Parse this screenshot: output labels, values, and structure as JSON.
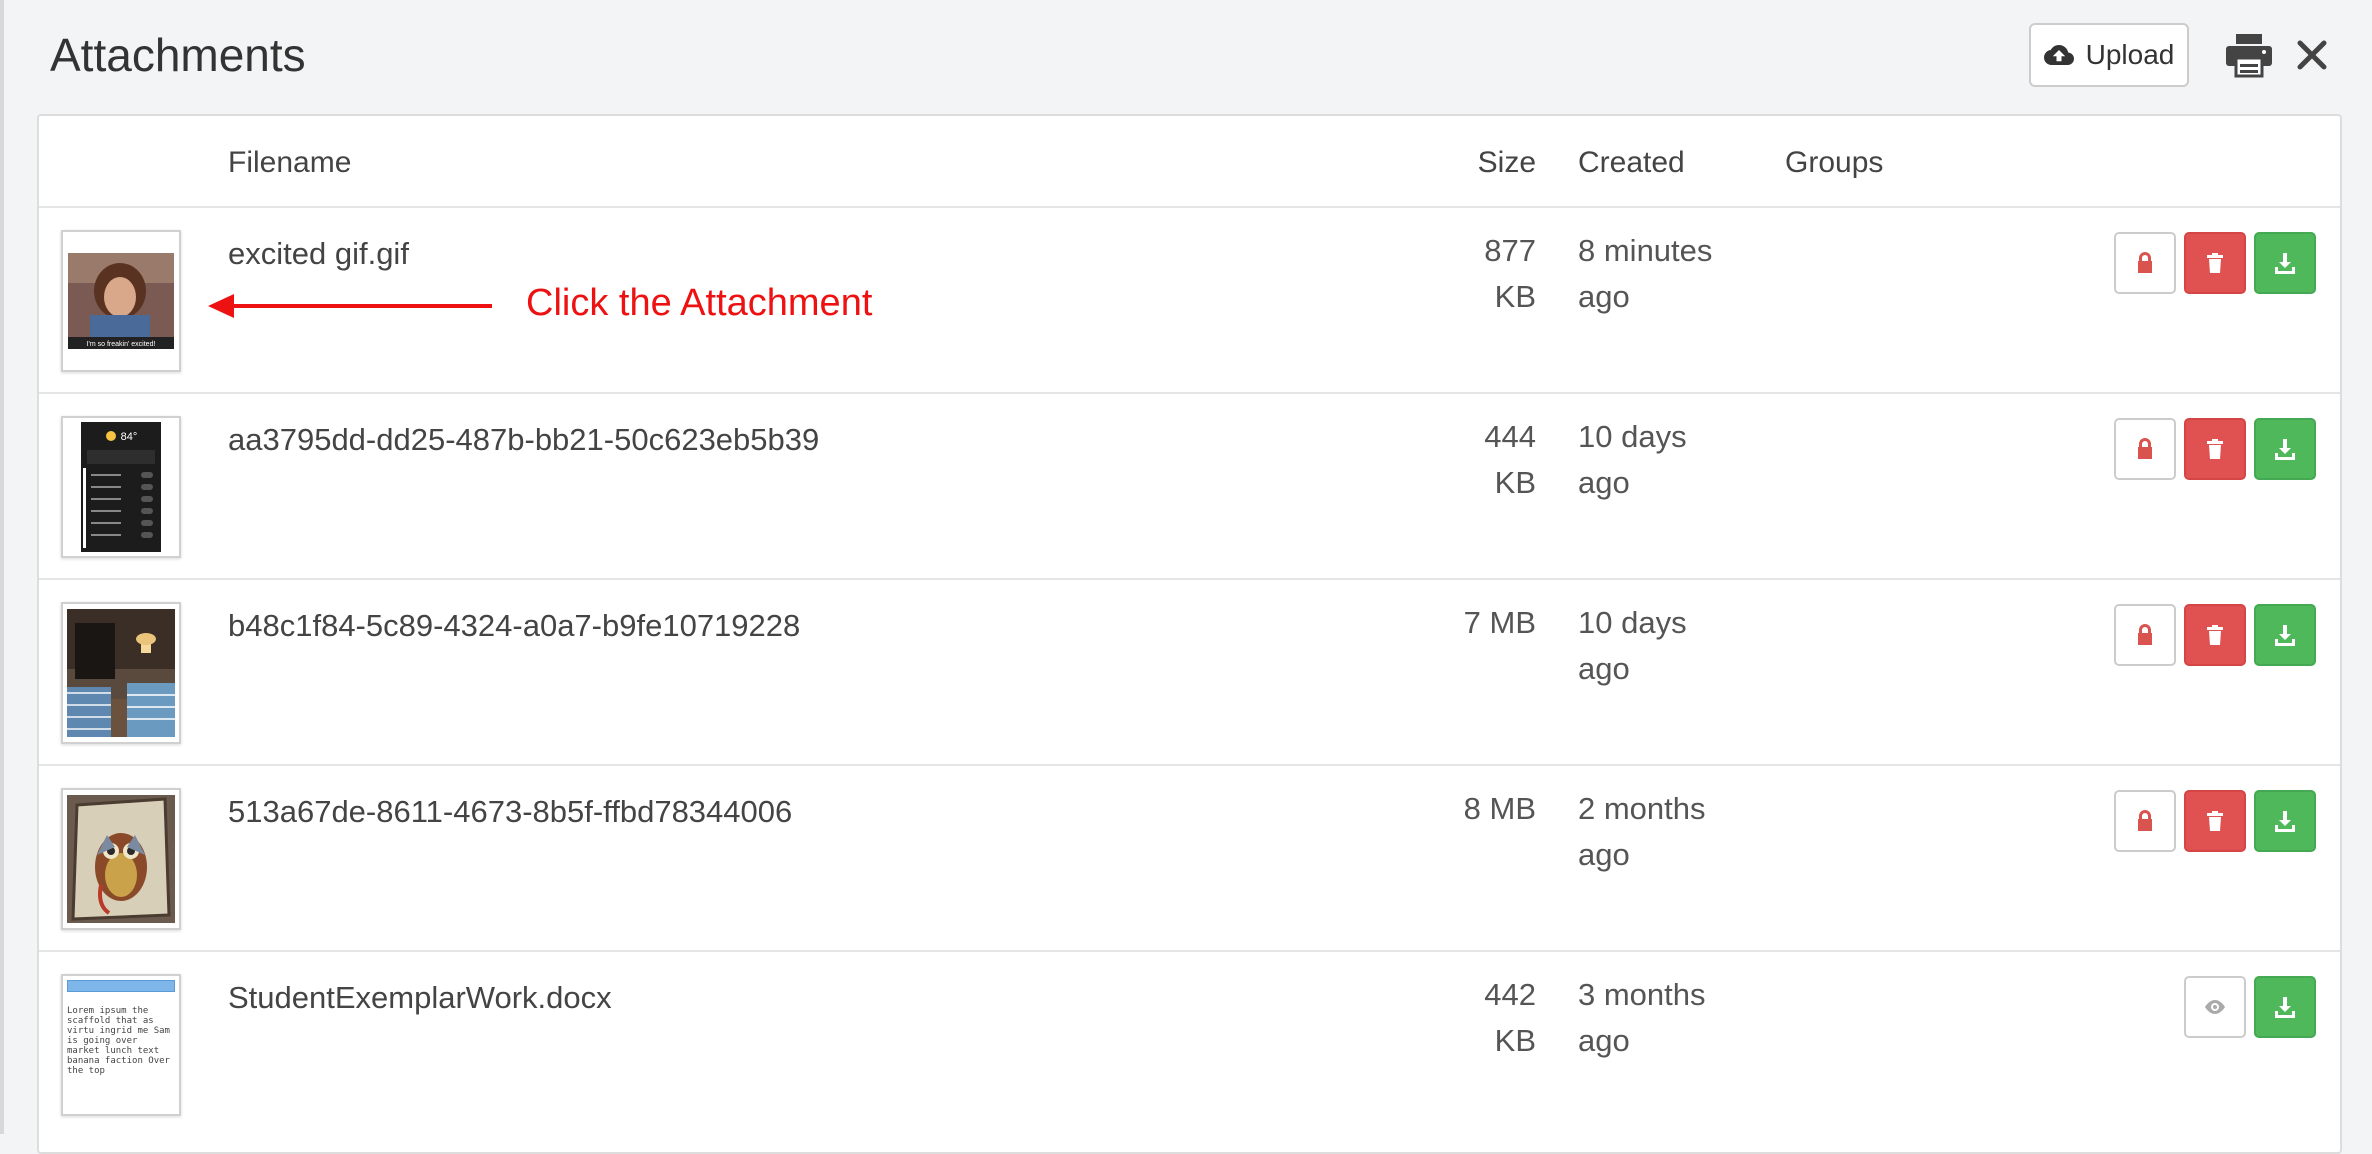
{
  "header": {
    "title": "Attachments",
    "upload_label": "Upload"
  },
  "table": {
    "columns": [
      "Filename",
      "Size",
      "Created",
      "Groups"
    ],
    "rows": [
      {
        "filename": "excited gif.gif",
        "size_line1": "877",
        "size_line2": "KB",
        "created_line1": "8 minutes",
        "created_line2": "ago",
        "thumb_caption": "I'm so freakin' excited!",
        "actions": [
          "lock",
          "delete",
          "download"
        ]
      },
      {
        "filename": "aa3795dd-dd25-487b-bb21-50c623eb5b39",
        "size_line1": "444",
        "size_line2": "KB",
        "created_line1": "10 days",
        "created_line2": "ago",
        "thumb_caption": "84°",
        "actions": [
          "lock",
          "delete",
          "download"
        ]
      },
      {
        "filename": "b48c1f84-5c89-4324-a0a7-b9fe10719228",
        "size_line1": "7 MB",
        "size_line2": "",
        "created_line1": "10 days",
        "created_line2": "ago",
        "thumb_caption": "",
        "actions": [
          "lock",
          "delete",
          "download"
        ]
      },
      {
        "filename": "513a67de-8611-4673-8b5f-ffbd78344006",
        "size_line1": "8 MB",
        "size_line2": "",
        "created_line1": "2 months",
        "created_line2": "ago",
        "thumb_caption": "",
        "actions": [
          "lock",
          "delete",
          "download"
        ]
      },
      {
        "filename": "StudentExemplarWork.docx",
        "size_line1": "442",
        "size_line2": "KB",
        "created_line1": "3 months",
        "created_line2": "ago",
        "thumb_caption": "Lorem ipsum the scaffold that as virtu ingrid me Sam is going over market lunch text banana faction Over the top",
        "actions": [
          "view",
          "download"
        ]
      }
    ]
  },
  "annotation": {
    "text": "Click the Attachment",
    "color": "#ee1111"
  },
  "colors": {
    "delete": "#e05252",
    "download": "#4fb85b",
    "lock_icon": "#d9534f"
  },
  "icons": {
    "upload": "cloud-upload-icon",
    "print": "print-icon",
    "close": "close-icon",
    "lock": "lock-icon",
    "delete": "trash-icon",
    "download": "download-icon",
    "view": "eye-icon"
  }
}
